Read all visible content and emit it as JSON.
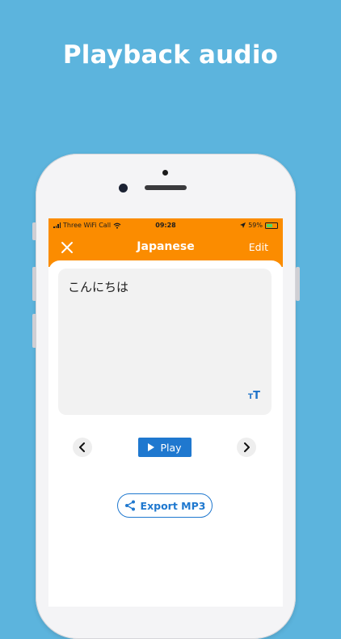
{
  "headline": "Playback audio",
  "status_bar": {
    "carrier": "Three WiFi Call",
    "time": "09:28",
    "battery": "59%"
  },
  "app_bar": {
    "title": "Japanese",
    "edit_label": "Edit",
    "close_icon": "close-icon"
  },
  "note": {
    "text": "こんにちは",
    "font_size_label_small": "T",
    "font_size_label_large": "T"
  },
  "playback": {
    "play_label": "Play",
    "prev_icon": "chevron-left-icon",
    "next_icon": "chevron-right-icon"
  },
  "export": {
    "label": "Export MP3",
    "icon": "share-icon"
  },
  "colors": {
    "background": "#5cb4dd",
    "accent_orange": "#fb8c00",
    "primary_blue": "#1f78cf"
  }
}
